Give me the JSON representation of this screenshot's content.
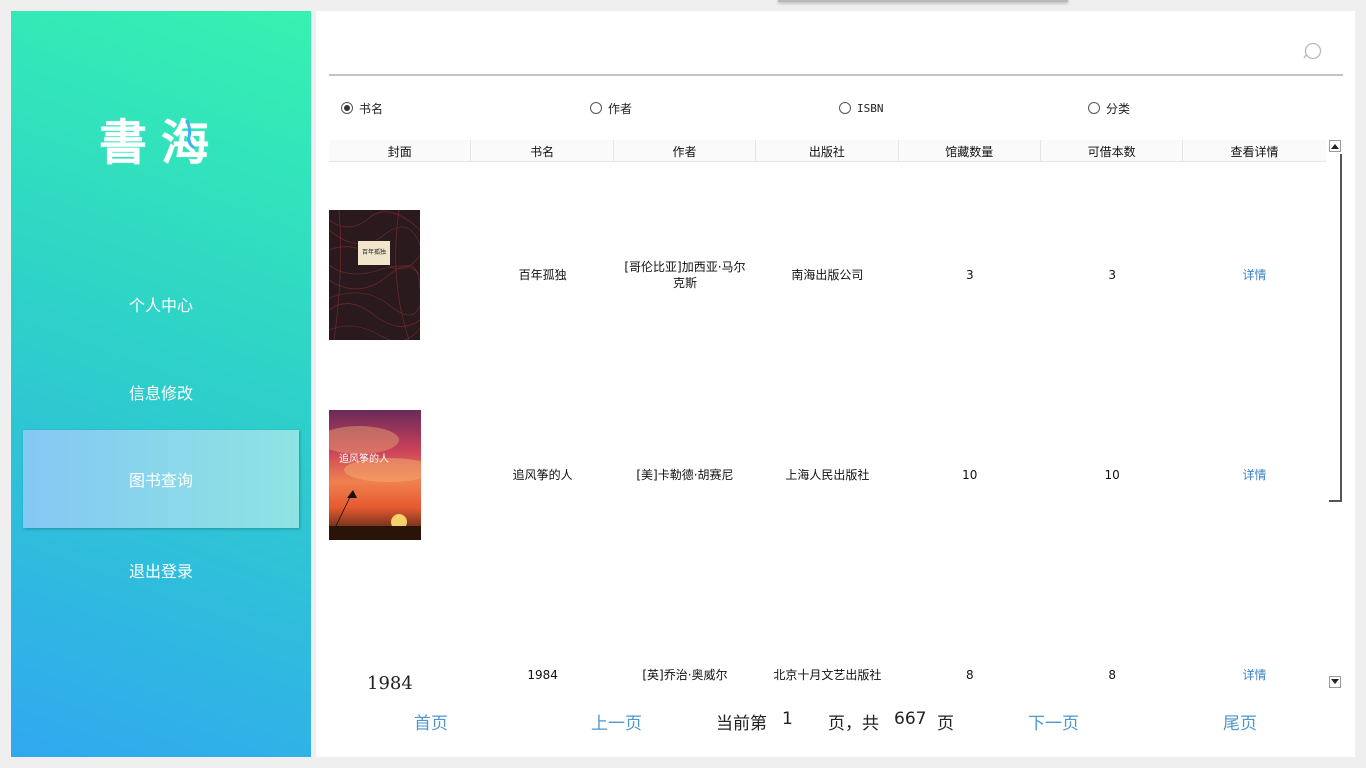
{
  "app": {
    "logo_main": "書",
    "logo_accent": "海"
  },
  "sidebar": {
    "items": [
      {
        "label": "个人中心"
      },
      {
        "label": "信息修改"
      },
      {
        "label": "图书查询"
      },
      {
        "label": "退出登录"
      }
    ]
  },
  "search": {
    "value": "",
    "placeholder": ""
  },
  "filters": [
    {
      "label": "书名",
      "checked": true
    },
    {
      "label": "作者",
      "checked": false
    },
    {
      "label": "ISBN",
      "checked": false
    },
    {
      "label": "分类",
      "checked": false
    }
  ],
  "table": {
    "headers": [
      "封面",
      "书名",
      "作者",
      "出版社",
      "馆藏数量",
      "可借本数",
      "查看详情"
    ],
    "rows": [
      {
        "title": "百年孤独",
        "author": "[哥伦比亚]加西亚·马尔克斯",
        "publisher": "南海出版公司",
        "holdings": "3",
        "available": "3",
        "detail": "详情"
      },
      {
        "title": "追风筝的人",
        "author": "[美]卡勒德·胡赛尼",
        "publisher": "上海人民出版社",
        "holdings": "10",
        "available": "10",
        "detail": "详情"
      },
      {
        "title": "1984",
        "author": "[英]乔治·奥威尔",
        "publisher": "北京十月文艺出版社",
        "holdings": "8",
        "available": "8",
        "detail": "详情"
      }
    ],
    "covers": [
      {
        "text": "百年孤独"
      },
      {
        "text": "追风筝的人"
      },
      {
        "text": "1984"
      }
    ]
  },
  "pager": {
    "first": "首页",
    "prev": "上一页",
    "current_prefix": "当前第",
    "current_page": "1",
    "mid": "页，共",
    "total_pages": "667",
    "suffix": "页",
    "next": "下一页",
    "last": "尾页"
  }
}
